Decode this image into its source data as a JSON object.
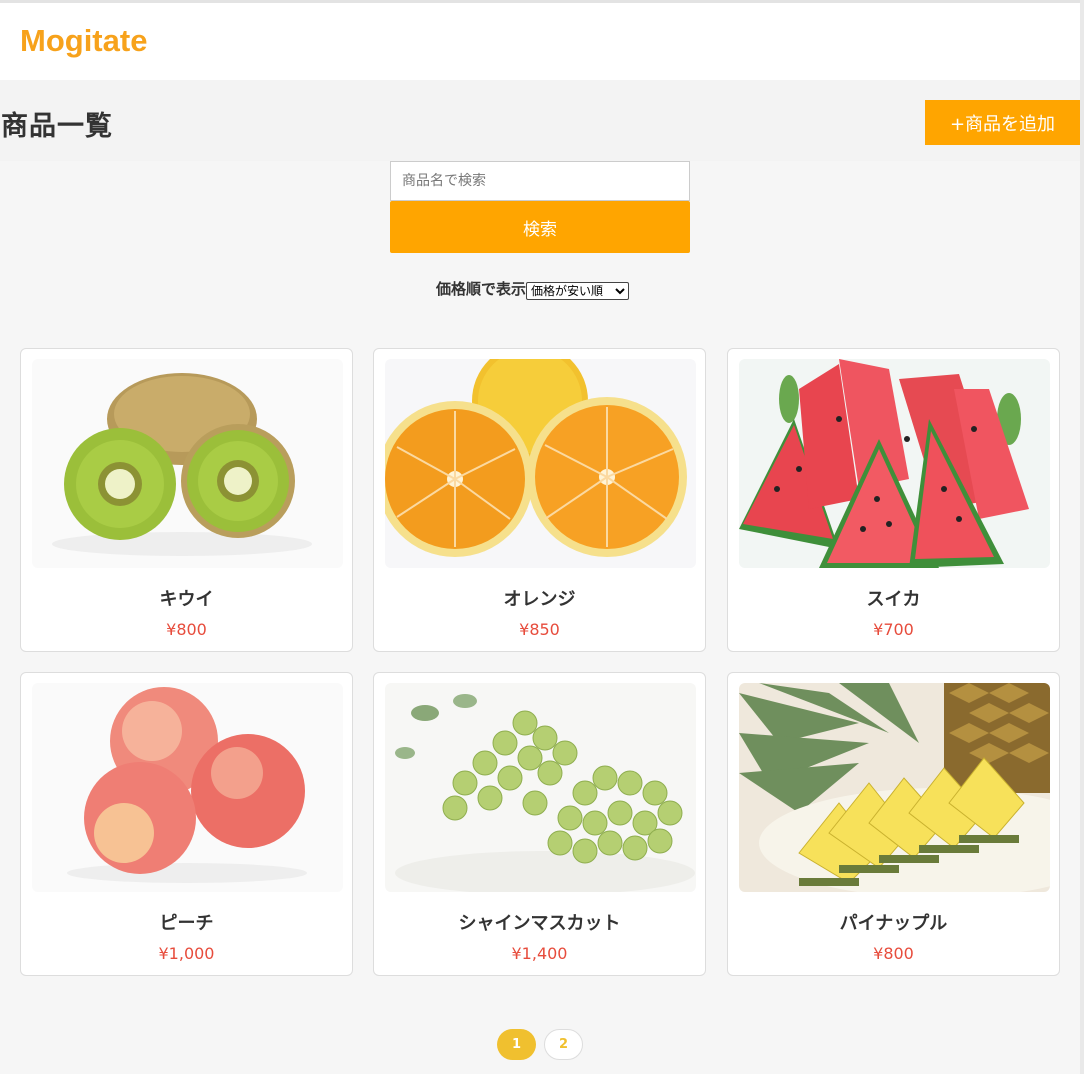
{
  "header": {
    "logo": "Mogitate"
  },
  "title_bar": {
    "title": "商品一覧",
    "add_button_label": "+商品を追加"
  },
  "search": {
    "placeholder": "商品名で検索",
    "button_label": "検索"
  },
  "sort": {
    "label": "価格順で表示",
    "selected": "価格が安い順"
  },
  "products": [
    {
      "name": "キウイ",
      "price": "¥800",
      "image": "kiwi-image"
    },
    {
      "name": "オレンジ",
      "price": "¥850",
      "image": "orange-image"
    },
    {
      "name": "スイカ",
      "price": "¥700",
      "image": "watermelon-image"
    },
    {
      "name": "ピーチ",
      "price": "¥1,000",
      "image": "peach-image"
    },
    {
      "name": "シャインマスカット",
      "price": "¥1,400",
      "image": "shine-muscat-image"
    },
    {
      "name": "パイナップル",
      "price": "¥800",
      "image": "pineapple-image"
    }
  ],
  "pagination": {
    "pages": [
      "1",
      "2"
    ],
    "current": "1"
  },
  "colors": {
    "brand": "#f7a21b",
    "button": "#ffa500",
    "price": "#e74c3c",
    "page_active": "#f0c02f"
  }
}
